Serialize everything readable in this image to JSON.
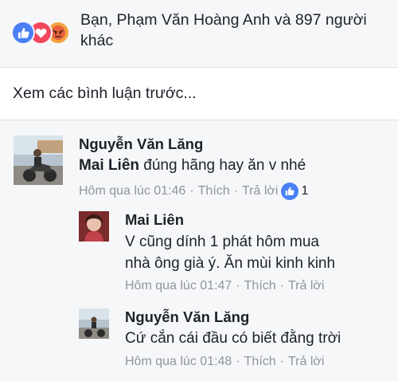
{
  "reactions": {
    "text": "Bạn, Phạm Văn Hoàng Anh và 897 người khác",
    "icons": [
      "like-icon",
      "love-icon",
      "angry-icon"
    ],
    "colors": {
      "like": "#4a80f4",
      "love": "#f2485e",
      "angry": "#f3a33f"
    }
  },
  "prev_comments": {
    "label": "Xem các bình luận trước..."
  },
  "comments": [
    {
      "author": "Nguyễn Văn Lăng",
      "mention": "Mai Liên",
      "text": "đúng hãng hay ăn v nhé",
      "time": "Hôm qua lúc 01:46",
      "like_label": "Thích",
      "reply_label": "Trả lời",
      "like_count": "1"
    },
    {
      "author": "Mai Liên",
      "text_line1": "V cũng dính 1 phát hôm mua",
      "text_line2": "nhà ông già ý. Ăn mùi kinh kinh",
      "time": "Hôm qua lúc 01:47",
      "like_label": "Thích",
      "reply_label": "Trả lời"
    },
    {
      "author": "Nguyễn Văn Lăng",
      "text": "Cứ cắn cái đầu có biết đằng trời",
      "time": "Hôm qua lúc 01:48",
      "like_label": "Thích",
      "reply_label": "Trả lời"
    }
  ]
}
